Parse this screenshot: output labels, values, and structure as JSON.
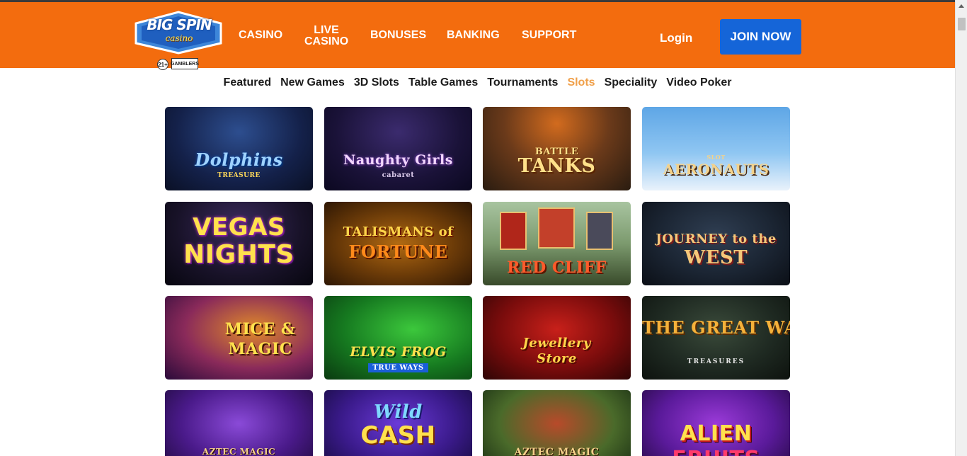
{
  "header": {
    "logo": {
      "title": "BIG SPIN",
      "subtitle": "casino",
      "age": "21+",
      "ga": "GAMBLERS"
    },
    "nav": [
      {
        "label": "CASINO"
      },
      {
        "label_line1": "LIVE",
        "label_line2": "CASINO"
      },
      {
        "label": "BONUSES"
      },
      {
        "label": "BANKING"
      },
      {
        "label": "SUPPORT"
      }
    ],
    "login_label": "Login",
    "join_label": "JOIN NOW",
    "colors": {
      "bar": "#f36c0e",
      "join": "#1565d8"
    }
  },
  "tabs": [
    {
      "label": "Featured",
      "active": false
    },
    {
      "label": "New Games",
      "active": false
    },
    {
      "label": "3D Slots",
      "active": false
    },
    {
      "label": "Table Games",
      "active": false
    },
    {
      "label": "Tournaments",
      "active": false
    },
    {
      "label": "Slots",
      "active": true
    },
    {
      "label": "Speciality",
      "active": false
    },
    {
      "label": "Video Poker",
      "active": false
    }
  ],
  "games": [
    {
      "title": "Dolphins",
      "sub": "TREASURE"
    },
    {
      "title": "Naughty Girls",
      "sub": "cabaret"
    },
    {
      "title": "BATTLE",
      "sub": "TANKS"
    },
    {
      "title": "SLOT",
      "sub": "AERONAUTS"
    },
    {
      "title": "VEGAS",
      "sub": "NIGHTS"
    },
    {
      "title": "TALISMANS of",
      "sub": "FORTUNE"
    },
    {
      "title": "",
      "sub": "RED CLIFF"
    },
    {
      "title": "JOURNEY to the",
      "sub": "WEST"
    },
    {
      "title": "MICE &",
      "sub": "MAGIC"
    },
    {
      "title": "ELVIS FROG",
      "sub": "TRUE WAYS"
    },
    {
      "title": "Jewellery",
      "sub": "Store"
    },
    {
      "title": "THE GREAT WALL",
      "sub": "TREASURES"
    },
    {
      "title": "",
      "sub": "AZTEC MAGIC"
    },
    {
      "title": "Wild",
      "sub": "CASH"
    },
    {
      "title": "",
      "sub": "AZTEC MAGIC"
    },
    {
      "title": "ALIEN",
      "sub": "FRUITS"
    }
  ]
}
